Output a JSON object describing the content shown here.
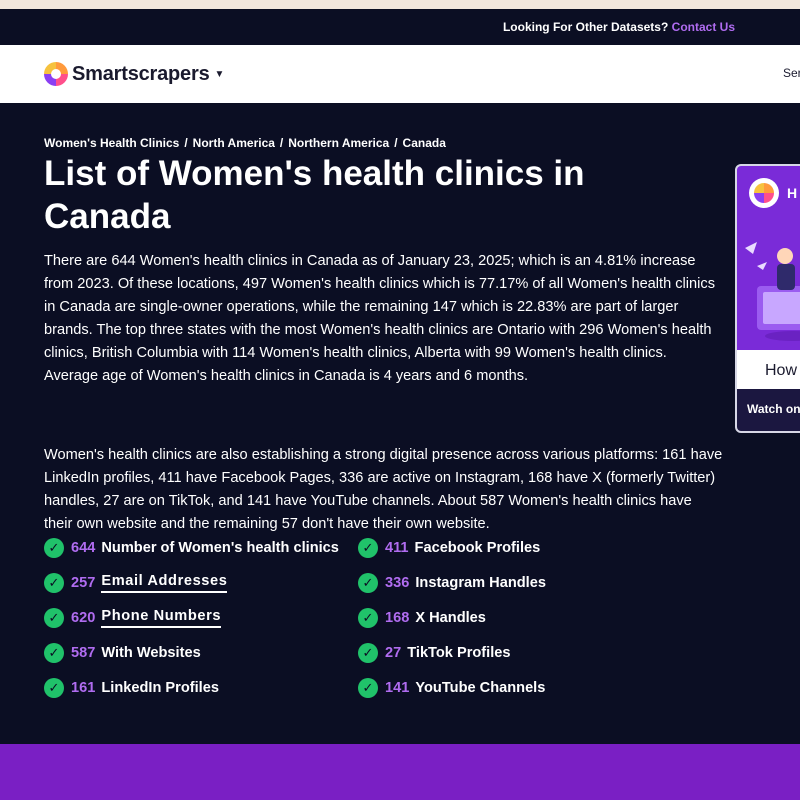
{
  "announcement": {
    "text": "Looking For Other Datasets?",
    "contact_label": "Contact Us"
  },
  "nav": {
    "brand": "Smartscrapers",
    "cut_item": "Ser"
  },
  "breadcrumb": [
    "Women's Health Clinics",
    "North America",
    "Northern America",
    "Canada"
  ],
  "page_title": "List of Women's health clinics in Canada",
  "paragraphs": [
    "There are 644 Women's health clinics in Canada as of January 23, 2025; which is an 4.81% increase from 2023. Of these locations, 497 Women's health clinics which is 77.17% of all Women's health clinics in Canada are single-owner operations, while the remaining 147 which is 22.83% are part of larger brands. The top three states with the most Women's health clinics are Ontario with 296 Women's health clinics, British Columbia with 114 Women's health clinics, Alberta with 99 Women's health clinics. Average age of Women's health clinics in Canada is 4 years and 6 months.",
    "Women's health clinics are also establishing a strong digital presence across various platforms: 161 have LinkedIn profiles, 411 have Facebook Pages, 336 are active on Instagram, 168 have X (formerly Twitter) handles, 27 are on TikTok, and 141 have YouTube channels. About 587 Women's health clinics have their own website and the remaining 57 don't have their own website."
  ],
  "stats_left": [
    {
      "num": "644",
      "label": "Number of Women's health clinics"
    },
    {
      "num": "257",
      "label": "Email Addresses"
    },
    {
      "num": "620",
      "label": "Phone Numbers"
    },
    {
      "num": "587",
      "label": "With Websites"
    },
    {
      "num": "161",
      "label": "LinkedIn Profiles"
    }
  ],
  "stats_right": [
    {
      "num": "411",
      "label": "Facebook Profiles"
    },
    {
      "num": "336",
      "label": "Instagram Handles"
    },
    {
      "num": "168",
      "label": "X Handles"
    },
    {
      "num": "27",
      "label": "TikTok Profiles"
    },
    {
      "num": "141",
      "label": "YouTube Channels"
    }
  ],
  "side_card": {
    "head_text": "H",
    "how_text": "How",
    "watch_text": "Watch on"
  },
  "icons": {
    "check": "check-circle-icon",
    "caret": "chevron-down-icon",
    "logo": "smartscrapers-logo"
  },
  "colors": {
    "background": "#0b0e23",
    "accent": "#b06cf0",
    "check": "#20c26a",
    "footer_band": "#7a1fc4"
  }
}
